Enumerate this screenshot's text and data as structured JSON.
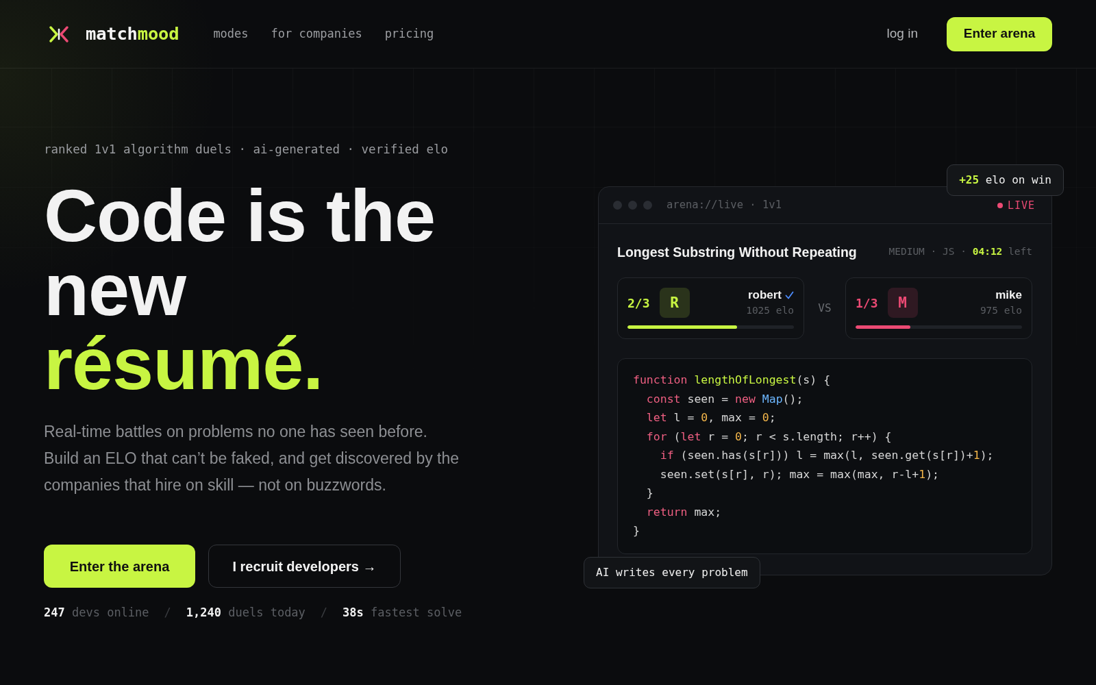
{
  "nav": {
    "brand": {
      "text": "match",
      "accent": "mood"
    },
    "links": [
      "modes",
      "for companies",
      "pricing"
    ],
    "login": "log in",
    "cta": "Enter arena"
  },
  "hero": {
    "tagline": "ranked 1v1 algorithm duels · ai-generated · verified elo",
    "headline": {
      "text": "Code is the new",
      "accent": "résumé."
    },
    "description": [
      "Real-time battles on problems no one has seen before.",
      "Build an ELO that can’t be faked, and get discovered by the companies that hire on skill — not on buzzwords."
    ],
    "buttons": [
      {
        "label": "Enter the arena",
        "kind": "primary"
      },
      {
        "label": "I recruit developers →",
        "kind": "outline"
      }
    ],
    "stats_separator": "/",
    "stats": [
      {
        "value": "247",
        "label": "devs online"
      },
      {
        "value": "1,240",
        "label": "duels today"
      },
      {
        "value": "38s",
        "label": "fastest solve"
      }
    ]
  },
  "arena": {
    "address": "arena://live · 1v1",
    "status": "LIVE",
    "badge": {
      "value": "+25",
      "label": "elo on win"
    },
    "problem": {
      "title": "Longest Substring Without Repeating",
      "difficulty": "MEDIUM",
      "separator": "·",
      "language": "JS",
      "timer": "04:12",
      "timer_label": "left"
    },
    "versus": "VS",
    "players": [
      {
        "score": "2/3",
        "initial": "R",
        "name": "robert",
        "verified": true,
        "elo": "1025 elo",
        "level": 0.66,
        "color": "#c8f542"
      },
      {
        "score": "1/3",
        "initial": "M",
        "name": "mike",
        "verified": false,
        "elo": "975 elo",
        "level": 0.33,
        "color": "#ec4a74"
      }
    ],
    "code": [
      [
        {
          "text": "function ",
          "kind": "keyword"
        },
        {
          "text": "lengthOfLongest",
          "kind": "function"
        },
        {
          "text": "(s) {",
          "kind": "plain"
        }
      ],
      [
        {
          "text": "  const",
          "kind": "keyword"
        },
        {
          "text": " seen = ",
          "kind": "plain"
        },
        {
          "text": "new ",
          "kind": "keyword"
        },
        {
          "text": "Map",
          "kind": "type"
        },
        {
          "text": "();",
          "kind": "plain"
        }
      ],
      [
        {
          "text": "  let",
          "kind": "keyword"
        },
        {
          "text": " l = ",
          "kind": "plain"
        },
        {
          "text": "0",
          "kind": "number"
        },
        {
          "text": ", max = ",
          "kind": "plain"
        },
        {
          "text": "0",
          "kind": "number"
        },
        {
          "text": ";",
          "kind": "plain"
        }
      ],
      [
        {
          "text": "  for",
          "kind": "keyword"
        },
        {
          "text": " (",
          "kind": "plain"
        },
        {
          "text": "let",
          "kind": "keyword"
        },
        {
          "text": " r = ",
          "kind": "plain"
        },
        {
          "text": "0",
          "kind": "number"
        },
        {
          "text": "; r < s.length; r++) {",
          "kind": "plain"
        }
      ],
      [
        {
          "text": "    if",
          "kind": "keyword"
        },
        {
          "text": " (seen.has(s[r])) l = max(l, seen.get(s[r])+",
          "kind": "plain"
        },
        {
          "text": "1",
          "kind": "number"
        },
        {
          "text": ");",
          "kind": "plain"
        }
      ],
      [
        {
          "text": "    seen.set(s[r], r); max = max(max, r-l+",
          "kind": "plain"
        },
        {
          "text": "1",
          "kind": "number"
        },
        {
          "text": ");",
          "kind": "plain"
        }
      ],
      [
        {
          "text": "  }",
          "kind": "plain"
        }
      ],
      [
        {
          "text": "  return",
          "kind": "keyword"
        },
        {
          "text": " max;",
          "kind": "plain"
        }
      ],
      [
        {
          "text": "}",
          "kind": "plain"
        }
      ]
    ],
    "caption": "AI writes every problem"
  }
}
